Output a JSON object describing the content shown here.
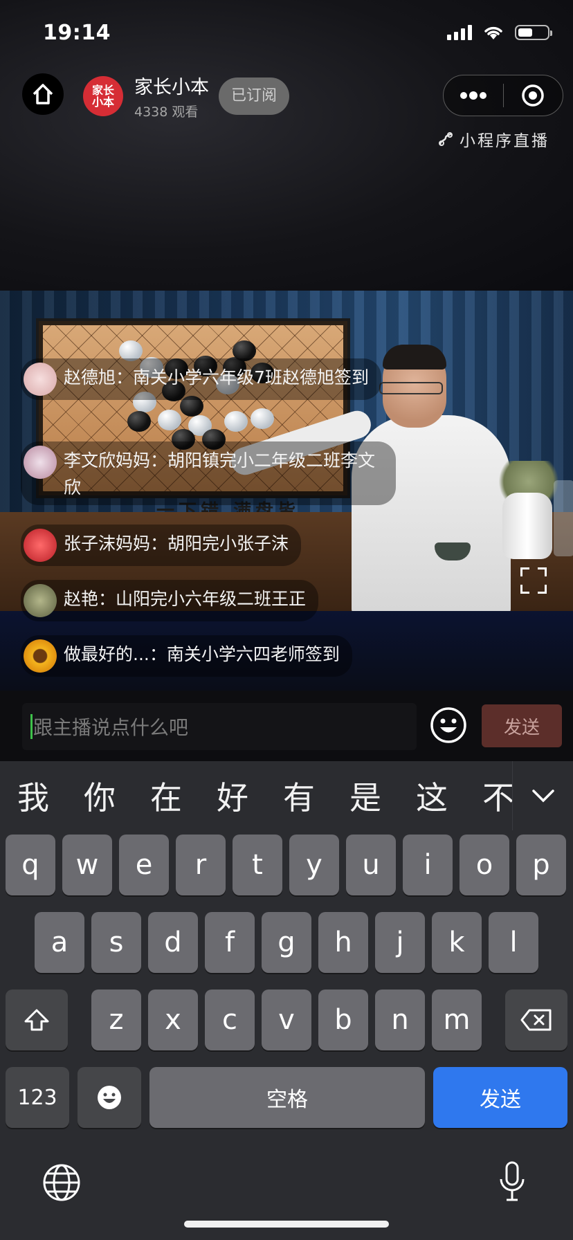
{
  "status_bar": {
    "time": "19:14"
  },
  "header": {
    "channel_logo_text": "家长小本",
    "channel_name": "家长小本",
    "views": "4338 观看",
    "subscribe_label": "已订阅",
    "mini_program_live": "小程序直播"
  },
  "video": {
    "board_caption": "一下错 满盘皆"
  },
  "comments": [
    {
      "user": "赵德旭",
      "text": "南关小学六年级7班赵德旭签到",
      "avatar_color": "#e9c9c9"
    },
    {
      "user": "李文欣妈妈",
      "text": "胡阳镇完小二年级二班李文欣",
      "avatar_color": "#c9a6b8"
    },
    {
      "user": "张子沫妈妈",
      "text": "胡阳完小张子沫",
      "avatar_color": "#d8383f"
    },
    {
      "user": "赵艳",
      "text": "山阳完小六年级二班王正",
      "avatar_color": "#8a8f6a"
    },
    {
      "user": "做最好的...",
      "text": "南关小学六四老师签到",
      "avatar_color": "#e8a321"
    }
  ],
  "input": {
    "placeholder": "跟主播说点什么吧",
    "send_label": "发送"
  },
  "keyboard": {
    "candidates": [
      "我",
      "你",
      "在",
      "好",
      "有",
      "是",
      "这",
      "不"
    ],
    "row1": [
      "q",
      "w",
      "e",
      "r",
      "t",
      "y",
      "u",
      "i",
      "o",
      "p"
    ],
    "row2": [
      "a",
      "s",
      "d",
      "f",
      "g",
      "h",
      "j",
      "k",
      "l"
    ],
    "row3": [
      "z",
      "x",
      "c",
      "v",
      "b",
      "n",
      "m"
    ],
    "numbers_label": "123",
    "space_label": "空格",
    "send_label": "发送"
  },
  "colors": {
    "send_blue": "#2f78ee",
    "channel_red": "#d62d35"
  }
}
